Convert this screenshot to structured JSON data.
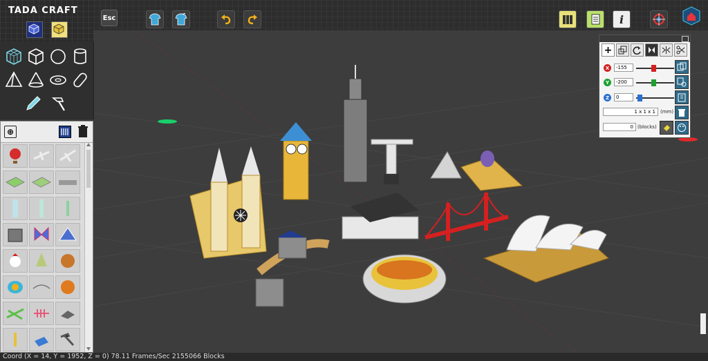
{
  "app": {
    "name": "TADA CRAFT"
  },
  "toolbar": {
    "esc_label": "Esc",
    "buttons": [
      "shirt-open-icon",
      "shirt-save-icon",
      "undo-icon",
      "redo-icon",
      "library-icon",
      "document-list-icon",
      "info-icon",
      "target-icon",
      "home-view-icon"
    ],
    "info_label": "i"
  },
  "shapes": [
    "cube-wire",
    "cube",
    "sphere",
    "cylinder",
    "pyramid",
    "cone",
    "torus",
    "capsule",
    "pencil",
    "hammer"
  ],
  "library": {
    "items": [
      "hot-air-balloon",
      "airplane",
      "jet-plane",
      "map-scene-1",
      "map-scene-2",
      "train",
      "glass-column",
      "glass-tube",
      "bottle",
      "building",
      "butterfly",
      "mountain-scene",
      "chicken",
      "tree",
      "cow-face",
      "fish-face",
      "bridge",
      "tiger-face",
      "grass",
      "fishbone",
      "car",
      "rocket",
      "solar-panel",
      "hammer"
    ]
  },
  "transform": {
    "x_value": "-155",
    "y_value": "-200",
    "z_value": "0",
    "size_value": "1 x 1 x 1",
    "size_unit": "(mm)",
    "blocks_value": "0",
    "blocks_unit": "(blocks)",
    "x_label": "X",
    "y_label": "Y",
    "z_label": "Z",
    "x_percent": 0.45,
    "y_percent": 0.45,
    "z_percent": 0.05
  },
  "status": {
    "text": "Coord (X = 14, Y = 1952, Z = 0)  78.11 Frames/Sec  2155066 Blocks"
  },
  "colors": {
    "accent": "#2e6a8a",
    "x": "#d42020",
    "y": "#1ea030",
    "z": "#2a6ed0"
  }
}
